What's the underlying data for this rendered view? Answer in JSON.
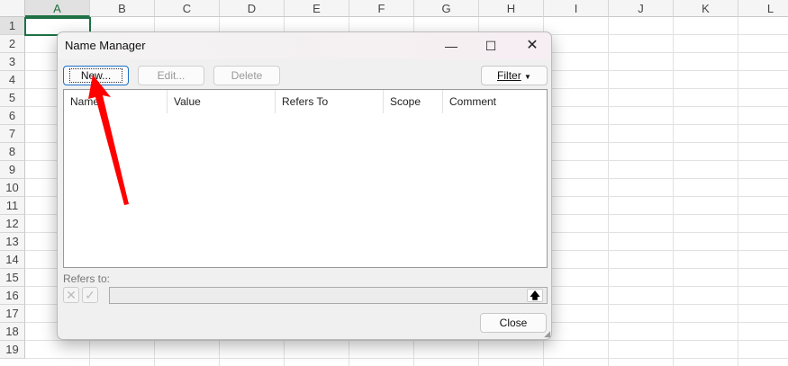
{
  "spreadsheet": {
    "columns": [
      "A",
      "B",
      "C",
      "D",
      "E",
      "F",
      "G",
      "H",
      "I",
      "J",
      "K",
      "L"
    ],
    "rows": [
      "1",
      "2",
      "3",
      "4",
      "5",
      "6",
      "7",
      "8",
      "9",
      "10",
      "11",
      "12",
      "13",
      "14",
      "15",
      "16",
      "17",
      "18",
      "19"
    ]
  },
  "dialog": {
    "title": "Name Manager",
    "buttons": {
      "new": "New...",
      "edit": "Edit...",
      "delete": "Delete",
      "filter": "Filter",
      "close": "Close"
    },
    "columns": [
      "Name",
      "Value",
      "Refers To",
      "Scope",
      "Comment"
    ],
    "refers_to_label": "Refers to:",
    "refers_to_value": ""
  },
  "colors": {
    "arrow": "#ff0000",
    "active_cell": "#1e7145",
    "focus": "#1a6fc9"
  }
}
